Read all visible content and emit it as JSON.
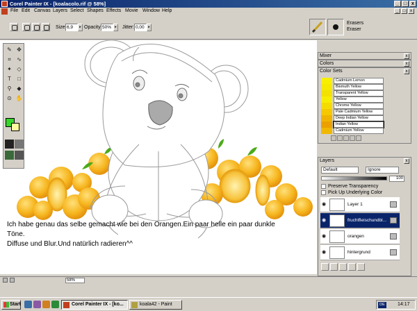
{
  "window": {
    "title": "Corel Painter IX - [koalacolo.rif @ 58%]",
    "min_glyph": "_",
    "max_glyph": "□",
    "close_glyph": "x"
  },
  "menu": {
    "items": [
      "File",
      "Edit",
      "Canvas",
      "Layers",
      "Select",
      "Shapes",
      "Effects",
      "Movie",
      "Window",
      "Help"
    ]
  },
  "property_bar": {
    "size_label": "Size:",
    "size_value": "6,9",
    "opacity_label": "Opacity:",
    "opacity_value": "50%",
    "jitter_label": "Jitter:",
    "jitter_value": "0,00"
  },
  "brush_selector": {
    "category": "Erasers",
    "variant": "Eraser"
  },
  "caption": {
    "line1": "Ich habe genau das selbe gemacht wie bei den Orangen.Ein paar helle ein paar dunkle",
    "line2": "Töne.",
    "line3": "Diffuse und Blur.Und natürlich radieren^^"
  },
  "toolbox": {
    "tools": [
      "brush-icon",
      "move-icon",
      "crop-icon",
      "lasso-icon",
      "magic-wand-icon",
      "shape-icon",
      "text-icon",
      "rectangle-select-icon",
      "dropper-icon",
      "paint-bucket-icon",
      "magnifier-icon",
      "grabber-icon"
    ],
    "main_color": "#36d62a",
    "additional_color": "#fffaa0"
  },
  "panels": {
    "mixer": "Mixer",
    "colors": "Colors",
    "color_sets": "Color Sets",
    "layers": "Layers",
    "close_glyph": "x"
  },
  "color_sets": [
    {
      "name": "Cadmium Lemon",
      "color": "#f7f000"
    },
    {
      "name": "Bismuth Yellow",
      "color": "#f5ea00"
    },
    {
      "name": "Transparent Yellow",
      "color": "#f3e100"
    },
    {
      "name": "Yellow",
      "color": "#f7ed00"
    },
    {
      "name": "Chrome Yellow",
      "color": "#f5dc00"
    },
    {
      "name": "Pale Cadmium Yellow",
      "color": "#f5c800"
    },
    {
      "name": "Deep Indian Yellow",
      "color": "#efb400"
    },
    {
      "name": "Indian Yellow",
      "color": "#eba000"
    },
    {
      "name": "Cadmium Yellow",
      "color": "#f0b800"
    }
  ],
  "layers_panel": {
    "composite_method": "Default",
    "preserve_mode": "Ignore",
    "opacity": "100",
    "preserve_transparency": "Preserve Transparency",
    "pick_up_underlying": "Pick Up Underlying Color",
    "layers": [
      {
        "name": "Layer 1",
        "selected": false
      },
      {
        "name": "fruchtfleischundbl...",
        "selected": true
      },
      {
        "name": "orangen",
        "selected": false
      },
      {
        "name": "hintergrund",
        "selected": false
      }
    ]
  },
  "status": {
    "zoom": "58%"
  },
  "taskbar": {
    "start": "Start",
    "buttons": [
      {
        "label": "Corel Painter IX - [ko...",
        "active": true
      },
      {
        "label": "koala42 - Paint",
        "active": false
      }
    ],
    "language": "DE",
    "clock": "14:17"
  }
}
